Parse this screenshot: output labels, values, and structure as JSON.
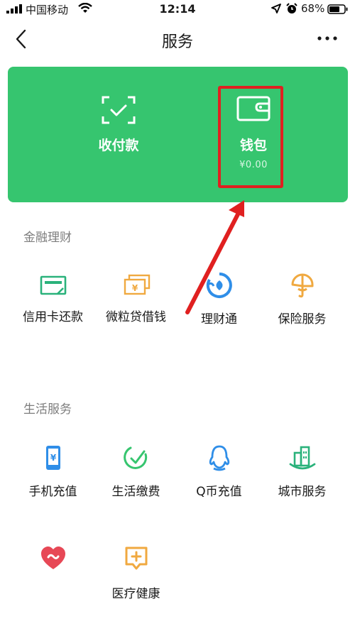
{
  "status": {
    "carrier": "中国移动",
    "time": "12:14",
    "battery": "68%",
    "icons": [
      "signal-icon",
      "wifi-icon",
      "location-icon",
      "alarm-icon",
      "battery-icon"
    ]
  },
  "nav": {
    "title": "服务",
    "icons": [
      "back-icon",
      "more-icon"
    ]
  },
  "card": {
    "background": "#36c56f",
    "pay": {
      "label": "收付款",
      "icon": "scan-pay-icon"
    },
    "wallet": {
      "label": "钱包",
      "balance": "¥0.00",
      "icon": "wallet-icon"
    },
    "highlight_color": "#e02020"
  },
  "sections": [
    {
      "title": "金融理财",
      "items": [
        {
          "label": "信用卡还款",
          "icon": "credit-card-icon",
          "color": "#2ab27b"
        },
        {
          "label": "微粒贷借钱",
          "icon": "cash-icon",
          "color": "#f0a940"
        },
        {
          "label": "理财通",
          "icon": "licaitong-icon",
          "color": "#2f8ee8"
        },
        {
          "label": "保险服务",
          "icon": "insurance-icon",
          "color": "#f0a940"
        }
      ]
    },
    {
      "title": "生活服务",
      "items": [
        {
          "label": "手机充值",
          "icon": "phone-icon",
          "color": "#2f8ee8"
        },
        {
          "label": "生活缴费",
          "icon": "bill-check-icon",
          "color": "#36c56f"
        },
        {
          "label": "Q币充值",
          "icon": "qq-icon",
          "color": "#2f8ee8"
        },
        {
          "label": "城市服务",
          "icon": "city-icon",
          "color": "#2ab27b"
        },
        {
          "label": "医疗健康",
          "icon": "health-icon",
          "color": "#e74856"
        }
      ]
    }
  ]
}
